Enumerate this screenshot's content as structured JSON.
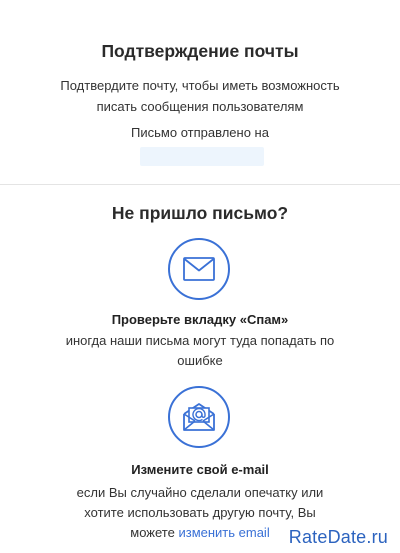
{
  "confirm": {
    "title": "Подтверждение почты",
    "description_line1": "Подтвердите почту, чтобы иметь возможность",
    "description_line2": "писать сообщения пользователям",
    "sent_label": "Письмо отправлено на"
  },
  "help": {
    "heading": "Не пришло письмо?",
    "tip1": {
      "title": "Проверьте вкладку «Спам»",
      "text_line1": "иногда наши письма могут туда попадать по",
      "text_line2": "ошибке"
    },
    "tip2": {
      "title": "Измените свой e-mail",
      "text_line1": "если Вы случайно сделали опечатку или",
      "text_line2": "хотите использовать другую почту, Вы",
      "text_prefix": "можете",
      "link_label": "изменить email"
    }
  },
  "watermark": "RateDate.ru",
  "icons": {
    "tip1": "envelope-icon",
    "tip2": "envelope-at-icon"
  },
  "colors": {
    "accent": "#3a71d6",
    "divider": "#e4e4e4",
    "email_mask": "#edf5fd"
  }
}
